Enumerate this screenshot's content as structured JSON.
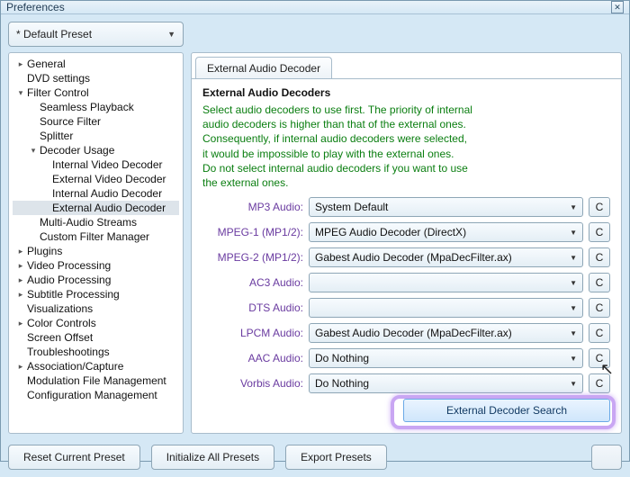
{
  "window": {
    "title": "Preferences"
  },
  "preset": {
    "label": "* Default Preset"
  },
  "tree": {
    "items": [
      {
        "label": "General",
        "expandable": true,
        "expanded": false,
        "depth": 0
      },
      {
        "label": "DVD settings",
        "expandable": false,
        "depth": 0
      },
      {
        "label": "Filter Control",
        "expandable": true,
        "expanded": true,
        "depth": 0
      },
      {
        "label": "Seamless Playback",
        "expandable": false,
        "depth": 1
      },
      {
        "label": "Source Filter",
        "expandable": false,
        "depth": 1
      },
      {
        "label": "Splitter",
        "expandable": false,
        "depth": 1
      },
      {
        "label": "Decoder Usage",
        "expandable": true,
        "expanded": true,
        "depth": 1
      },
      {
        "label": "Internal Video Decoder",
        "expandable": false,
        "depth": 2
      },
      {
        "label": "External Video Decoder",
        "expandable": false,
        "depth": 2
      },
      {
        "label": "Internal Audio Decoder",
        "expandable": false,
        "depth": 2
      },
      {
        "label": "External Audio Decoder",
        "expandable": false,
        "depth": 2,
        "selected": true
      },
      {
        "label": "Multi-Audio Streams",
        "expandable": false,
        "depth": 1
      },
      {
        "label": "Custom Filter Manager",
        "expandable": false,
        "depth": 1
      },
      {
        "label": "Plugins",
        "expandable": true,
        "expanded": false,
        "depth": 0
      },
      {
        "label": "Video Processing",
        "expandable": true,
        "expanded": false,
        "depth": 0
      },
      {
        "label": "Audio Processing",
        "expandable": true,
        "expanded": false,
        "depth": 0
      },
      {
        "label": "Subtitle Processing",
        "expandable": true,
        "expanded": false,
        "depth": 0
      },
      {
        "label": "Visualizations",
        "expandable": false,
        "depth": 0
      },
      {
        "label": "Color Controls",
        "expandable": true,
        "expanded": false,
        "depth": 0
      },
      {
        "label": "Screen Offset",
        "expandable": false,
        "depth": 0
      },
      {
        "label": "Troubleshootings",
        "expandable": false,
        "depth": 0
      },
      {
        "label": "Association/Capture",
        "expandable": true,
        "expanded": false,
        "depth": 0
      },
      {
        "label": "Modulation File Management",
        "expandable": false,
        "depth": 0
      },
      {
        "label": "Configuration Management",
        "expandable": false,
        "depth": 0
      }
    ]
  },
  "tab": {
    "label": "External Audio Decoder"
  },
  "section": {
    "title": "External Audio Decoders",
    "hint": "Select audio decoders to use first. The priority of internal\naudio decoders is higher than that of the external ones.\nConsequently, if internal audio decoders were selected,\nit would be impossible to play with the external ones.\nDo not select internal audio decoders if you want to use\nthe external ones."
  },
  "rows": [
    {
      "label": "MP3 Audio:",
      "value": "System Default",
      "btn": "C"
    },
    {
      "label": "MPEG-1 (MP1/2):",
      "value": "MPEG Audio Decoder (DirectX)",
      "btn": "C"
    },
    {
      "label": "MPEG-2 (MP1/2):",
      "value": "Gabest Audio Decoder (MpaDecFilter.ax)",
      "btn": "C"
    },
    {
      "label": "AC3 Audio:",
      "value": "",
      "btn": "C"
    },
    {
      "label": "DTS Audio:",
      "value": "",
      "btn": "C"
    },
    {
      "label": "LPCM Audio:",
      "value": "Gabest Audio Decoder (MpaDecFilter.ax)",
      "btn": "C"
    },
    {
      "label": "AAC Audio:",
      "value": "Do Nothing",
      "btn": "C"
    },
    {
      "label": "Vorbis Audio:",
      "value": "Do Nothing",
      "btn": "C"
    }
  ],
  "buttons": {
    "search": "External Decoder Search",
    "reset": "Reset Current Preset",
    "init": "Initialize All Presets",
    "export": "Export Presets",
    "ghost": " "
  }
}
